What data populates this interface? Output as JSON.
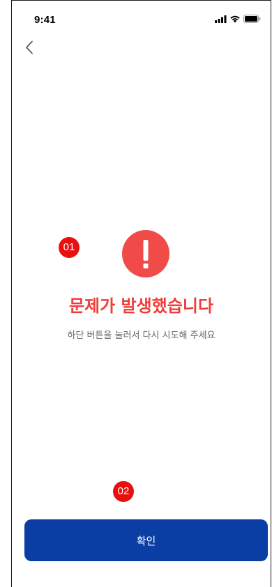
{
  "status_bar": {
    "time": "9:41",
    "icons": [
      "signal-icon",
      "wifi-icon",
      "battery-icon"
    ]
  },
  "nav": {
    "back_icon": "chevron-left-icon"
  },
  "markers": {
    "first": "01",
    "second": "02"
  },
  "error": {
    "icon": "exclamation-icon",
    "title": "문제가 발생했습니다",
    "description": "하단 버튼을 눌러서 다시 시도해 주세요"
  },
  "footer": {
    "confirm_label": "확인"
  },
  "colors": {
    "error": "#ef3e3a",
    "marker": "#e8110f",
    "primary_button": "#0a3ea4"
  }
}
